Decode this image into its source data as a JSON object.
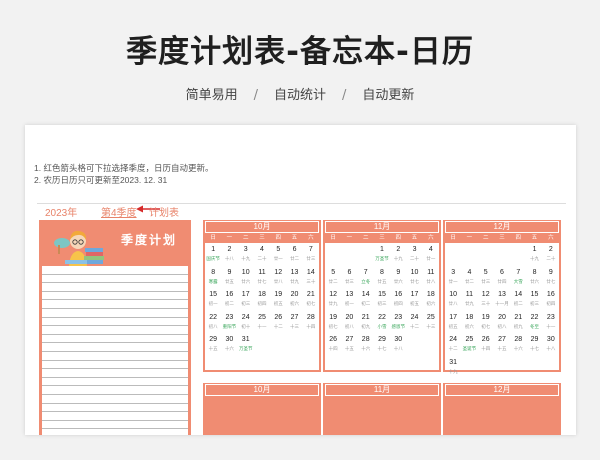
{
  "banner": {
    "title": "季度计划表-备忘本-日历",
    "subtitle": [
      "简单易用",
      "自动统计",
      "自动更新"
    ],
    "separator": "/"
  },
  "notes": [
    "1. 红色箭头格可下拉选择季度，日历自动更新。",
    "2. 农历日历只可更新至2023. 12. 31"
  ],
  "header": {
    "year": "2023年",
    "quarter": "第4季度",
    "suffix": "计划表"
  },
  "plan": {
    "title": "季度计划",
    "line_count": 19
  },
  "colors": {
    "accent": "#f08c72",
    "festival": "#3aa65b"
  },
  "weekdays": [
    "日",
    "一",
    "二",
    "三",
    "四",
    "五",
    "六"
  ],
  "calendars": [
    {
      "title": "10月",
      "weeks": [
        [
          [
            "1",
            "国庆节"
          ],
          [
            "2",
            "十八"
          ],
          [
            "3",
            "十九"
          ],
          [
            "4",
            "二十"
          ],
          [
            "5",
            "廿一"
          ],
          [
            "6",
            "廿二"
          ],
          [
            "7",
            "廿三"
          ]
        ],
        [
          [
            "8",
            "寒露"
          ],
          [
            "9",
            "廿五"
          ],
          [
            "10",
            "廿六"
          ],
          [
            "11",
            "廿七"
          ],
          [
            "12",
            "廿八"
          ],
          [
            "13",
            "廿九"
          ],
          [
            "14",
            "三十"
          ]
        ],
        [
          [
            "15",
            "初一"
          ],
          [
            "16",
            "初二"
          ],
          [
            "17",
            "初三"
          ],
          [
            "18",
            "初四"
          ],
          [
            "19",
            "初五"
          ],
          [
            "20",
            "初六"
          ],
          [
            "21",
            "初七"
          ]
        ],
        [
          [
            "22",
            "初八"
          ],
          [
            "23",
            "重阳节"
          ],
          [
            "24",
            "初十"
          ],
          [
            "25",
            "十一"
          ],
          [
            "26",
            "十二"
          ],
          [
            "27",
            "十三"
          ],
          [
            "28",
            "十四"
          ]
        ],
        [
          [
            "29",
            "十五"
          ],
          [
            "30",
            "十六"
          ],
          [
            "31",
            "万圣节"
          ],
          [
            "",
            ""
          ],
          [
            "",
            ""
          ],
          [
            "",
            ""
          ],
          [
            "",
            ""
          ]
        ]
      ]
    },
    {
      "title": "11月",
      "weeks": [
        [
          [
            "",
            ""
          ],
          [
            "",
            ""
          ],
          [
            "",
            ""
          ],
          [
            "1",
            "万圣节"
          ],
          [
            "2",
            "十九"
          ],
          [
            "3",
            "二十"
          ],
          [
            "4",
            "廿一"
          ]
        ],
        [
          [
            "5",
            "廿二"
          ],
          [
            "6",
            "廿三"
          ],
          [
            "7",
            "立冬"
          ],
          [
            "8",
            "廿五"
          ],
          [
            "9",
            "廿六"
          ],
          [
            "10",
            "廿七"
          ],
          [
            "11",
            "廿八"
          ]
        ],
        [
          [
            "12",
            "廿九"
          ],
          [
            "13",
            "初一"
          ],
          [
            "14",
            "初二"
          ],
          [
            "15",
            "初三"
          ],
          [
            "16",
            "初四"
          ],
          [
            "17",
            "初五"
          ],
          [
            "18",
            "初六"
          ]
        ],
        [
          [
            "19",
            "初七"
          ],
          [
            "20",
            "初八"
          ],
          [
            "21",
            "初九"
          ],
          [
            "22",
            "小雪"
          ],
          [
            "23",
            "感恩节"
          ],
          [
            "24",
            "十二"
          ],
          [
            "25",
            "十三"
          ]
        ],
        [
          [
            "26",
            "十四"
          ],
          [
            "27",
            "十五"
          ],
          [
            "28",
            "十六"
          ],
          [
            "29",
            "十七"
          ],
          [
            "30",
            "十八"
          ],
          [
            "",
            ""
          ],
          [
            "",
            ""
          ]
        ]
      ]
    },
    {
      "title": "12月",
      "weeks": [
        [
          [
            "",
            ""
          ],
          [
            "",
            ""
          ],
          [
            "",
            ""
          ],
          [
            "",
            ""
          ],
          [
            "",
            ""
          ],
          [
            "1",
            "十九"
          ],
          [
            "2",
            "二十"
          ]
        ],
        [
          [
            "3",
            "廿一"
          ],
          [
            "4",
            "廿二"
          ],
          [
            "5",
            "廿三"
          ],
          [
            "6",
            "廿四"
          ],
          [
            "7",
            "大雪"
          ],
          [
            "8",
            "廿六"
          ],
          [
            "9",
            "廿七"
          ]
        ],
        [
          [
            "10",
            "廿八"
          ],
          [
            "11",
            "廿九"
          ],
          [
            "12",
            "三十"
          ],
          [
            "13",
            "十一月"
          ],
          [
            "14",
            "初二"
          ],
          [
            "15",
            "初三"
          ],
          [
            "16",
            "初四"
          ]
        ],
        [
          [
            "17",
            "初五"
          ],
          [
            "18",
            "初六"
          ],
          [
            "19",
            "初七"
          ],
          [
            "20",
            "初八"
          ],
          [
            "21",
            "初九"
          ],
          [
            "22",
            "冬至"
          ],
          [
            "23",
            "十一"
          ]
        ],
        [
          [
            "24",
            "十二"
          ],
          [
            "25",
            "圣诞节"
          ],
          [
            "26",
            "十四"
          ],
          [
            "27",
            "十五"
          ],
          [
            "28",
            "十六"
          ],
          [
            "29",
            "十七"
          ],
          [
            "30",
            "十八"
          ]
        ],
        [
          [
            "31",
            "十九"
          ],
          [
            "",
            ""
          ],
          [
            "",
            ""
          ],
          [
            "",
            ""
          ],
          [
            "",
            ""
          ],
          [
            "",
            ""
          ],
          [
            "",
            ""
          ]
        ]
      ]
    }
  ],
  "bottom_calendars": [
    "10月",
    "11月",
    "12月"
  ]
}
